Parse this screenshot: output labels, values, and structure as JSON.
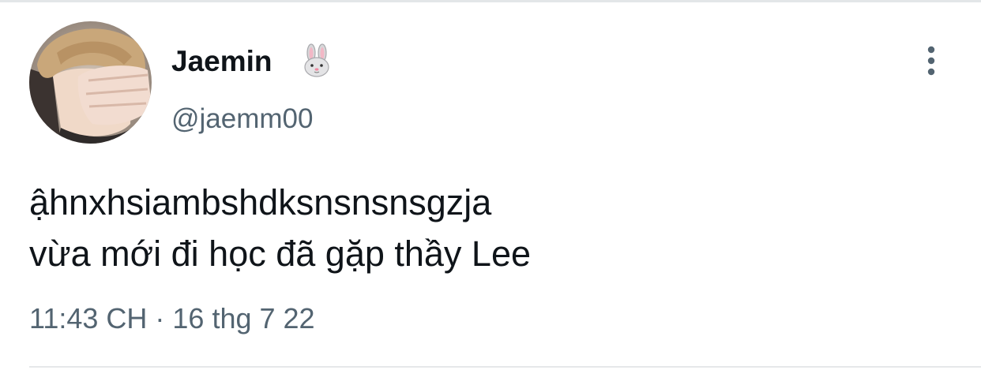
{
  "user": {
    "display_name": "Jaemin",
    "name_emoji": "rabbit-face-emoji",
    "handle": "@jaemm00",
    "avatar": "profile-photo"
  },
  "tweet": {
    "lines": [
      "ậhnxhsiambshdksnsnsnsgzja",
      "vừa mới đi học đã gặp thầy Lee"
    ],
    "timestamp": "11:43 CH · 16 thg 7 22"
  },
  "actions": {
    "more_icon": "more-vertical-icon"
  },
  "colors": {
    "text_primary": "#0f1419",
    "text_secondary": "#536471",
    "divider": "#e6e8ea",
    "background": "#ffffff"
  }
}
